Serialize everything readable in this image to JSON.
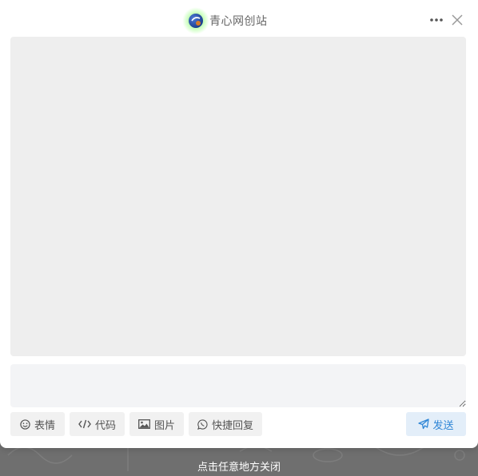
{
  "header": {
    "brand_name": "青心网创站",
    "logo_icon": "site-logo-icon",
    "more_icon": "more-horizontal-icon",
    "close_icon": "close-icon"
  },
  "chat": {
    "input_value": "",
    "input_placeholder": ""
  },
  "toolbar": {
    "emoji_label": "表情",
    "emoji_icon": "smile-icon",
    "code_label": "代码",
    "code_icon": "code-icon",
    "image_label": "图片",
    "image_icon": "image-icon",
    "quick_reply_label": "快捷回复",
    "quick_reply_icon": "whatsapp-icon",
    "send_label": "发送",
    "send_icon": "paper-plane-icon"
  },
  "overlay": {
    "close_hint": "点击任意地方关闭"
  },
  "colors": {
    "accent": "#2f86d6",
    "send_bg": "#e3eef9",
    "chat_bg": "#eeeeee",
    "overlay_bg": "#6f6f6f"
  }
}
